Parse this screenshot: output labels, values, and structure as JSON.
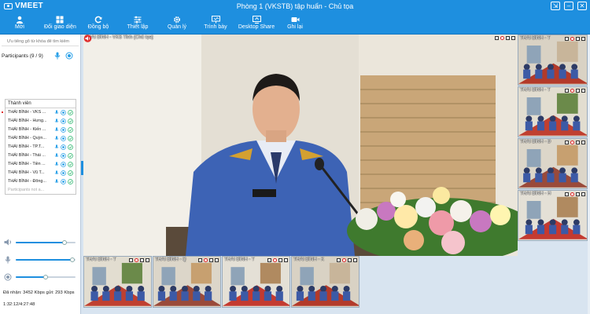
{
  "app": {
    "logo": "VMEET",
    "window_title": "Phòng 1 (VKSTB) tập huấn - Chủ tọa"
  },
  "window_controls": [
    "⇲",
    "–",
    "✕"
  ],
  "toolbar": {
    "items": [
      {
        "label": "Mời",
        "icon": "user-icon"
      },
      {
        "label": "Đổi giao diện",
        "icon": "layout-grid-icon"
      },
      {
        "label": "Đồng bộ",
        "icon": "sync-icon"
      },
      {
        "label": "Thiết lập",
        "icon": "sliders-icon"
      },
      {
        "label": "Quản lý",
        "icon": "gear-icon"
      },
      {
        "label": "Trình bày",
        "icon": "presentation-icon"
      },
      {
        "label": "Desktop Share",
        "icon": "monitor-share-icon"
      },
      {
        "label": "Ghi lại",
        "icon": "record-icon"
      }
    ]
  },
  "left_panel": {
    "search_placeholder": "Ưu tiêng gõ từ khóa để tìm kiếm",
    "participants_label": "Participants (9 / 9)",
    "list_header": "Thành viên",
    "participants": [
      "THÁI BÌNH - VKS ...",
      "THÁI BÌNH - Hưng...",
      "THÁI BÌNH - Kiến ...",
      "THÁI BÌNH - Quỳn...",
      "THÁI BÌNH - TP.T...",
      "THÁI BÌNH - Thái ...",
      "THÁI BÌNH - Tiền ...",
      "THÁI BÌNH - Vũ T...",
      "THÁI BÌNH - Đông..."
    ],
    "more_label": "Participants not a...",
    "sliders": {
      "speaker": 0.82,
      "mic": 0.95,
      "camera": 0.5
    },
    "stats": "Đã nhận: 3452 Kbps gửi: 293 Kbps",
    "timer": "1:32:12/4:27:48"
  },
  "main_video": {
    "label": "THÁI BÌNH - VKS Tỉnh (Chủ tọa)"
  },
  "right_thumbs": [
    {
      "label": "THÁI BÌNH - T"
    },
    {
      "label": "THÁI BÌNH - T"
    },
    {
      "label": "THÁI BÌNH - Đ"
    },
    {
      "label": "THÁI BÌNH - H"
    }
  ],
  "bottom_thumbs": [
    {
      "label": "THÁI BÌNH - T"
    },
    {
      "label": "THÁI BÌNH - Q"
    },
    {
      "label": "THÁI BÌNH - T"
    },
    {
      "label": "THÁI BÌNH - K"
    }
  ],
  "colors": {
    "brand": "#1e8fdf",
    "accent_red": "#e03030"
  }
}
